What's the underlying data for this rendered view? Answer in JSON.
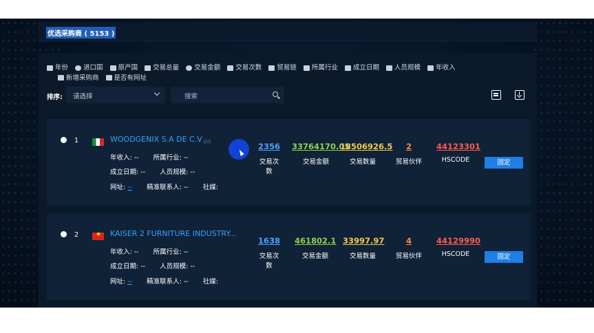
{
  "header": {
    "title": "优选采购商 ( 5153 )"
  },
  "filters": [
    "年份",
    "进口国",
    "原产国",
    "交易总量",
    "交易金额",
    "交易次数",
    "贸易链",
    "所属行业",
    "成立日期",
    "人员规模",
    "年收入",
    "新增采购商",
    "是否有网址"
  ],
  "sort": {
    "label": "排序:",
    "placeholder": "请选择"
  },
  "search": {
    "placeholder": "搜索"
  },
  "labels": {
    "revenue": "年收入:",
    "industry": "所属行业:",
    "founded": "成立日期:",
    "staff": "人员规模:",
    "website": "网址:",
    "contact": "精准联系人:",
    "social": "社媒:",
    "m_count": "交易次数",
    "m_amount": "交易金额",
    "m_qty": "交易数量",
    "m_partner": "贸易伙伴",
    "m_hs": "HSCODE",
    "fix": "固定"
  },
  "colors": {
    "count": "#4aa3ff",
    "amount": "#8fd14f",
    "qty": "#f5c84b",
    "partner": "#ff8a3d",
    "hs": "#ff5a50",
    "button": "#1e7fe6"
  },
  "cards": [
    {
      "index": "1",
      "flag": "mexico-flag",
      "name": "WOODGENIX S.A DE C.V",
      "tag": "必应",
      "revenue": "--",
      "industry": "--",
      "founded": "--",
      "staff": "--",
      "website": "--",
      "contact": "--",
      "social": "",
      "count": "2356",
      "amount": "33764170.05",
      "qty": "18506926.5",
      "partner": "2",
      "hscode": "44123301"
    },
    {
      "index": "2",
      "flag": "vietnam-flag",
      "name": "KAISER 2 FURNITURE INDUSTRY...",
      "revenue": "--",
      "industry": "--",
      "founded": "--",
      "staff": "--",
      "website": "--",
      "contact": "--",
      "social": "",
      "count": "1638",
      "amount": "461802.1",
      "qty": "33997.97",
      "partner": "4",
      "hscode": "44129990"
    }
  ]
}
